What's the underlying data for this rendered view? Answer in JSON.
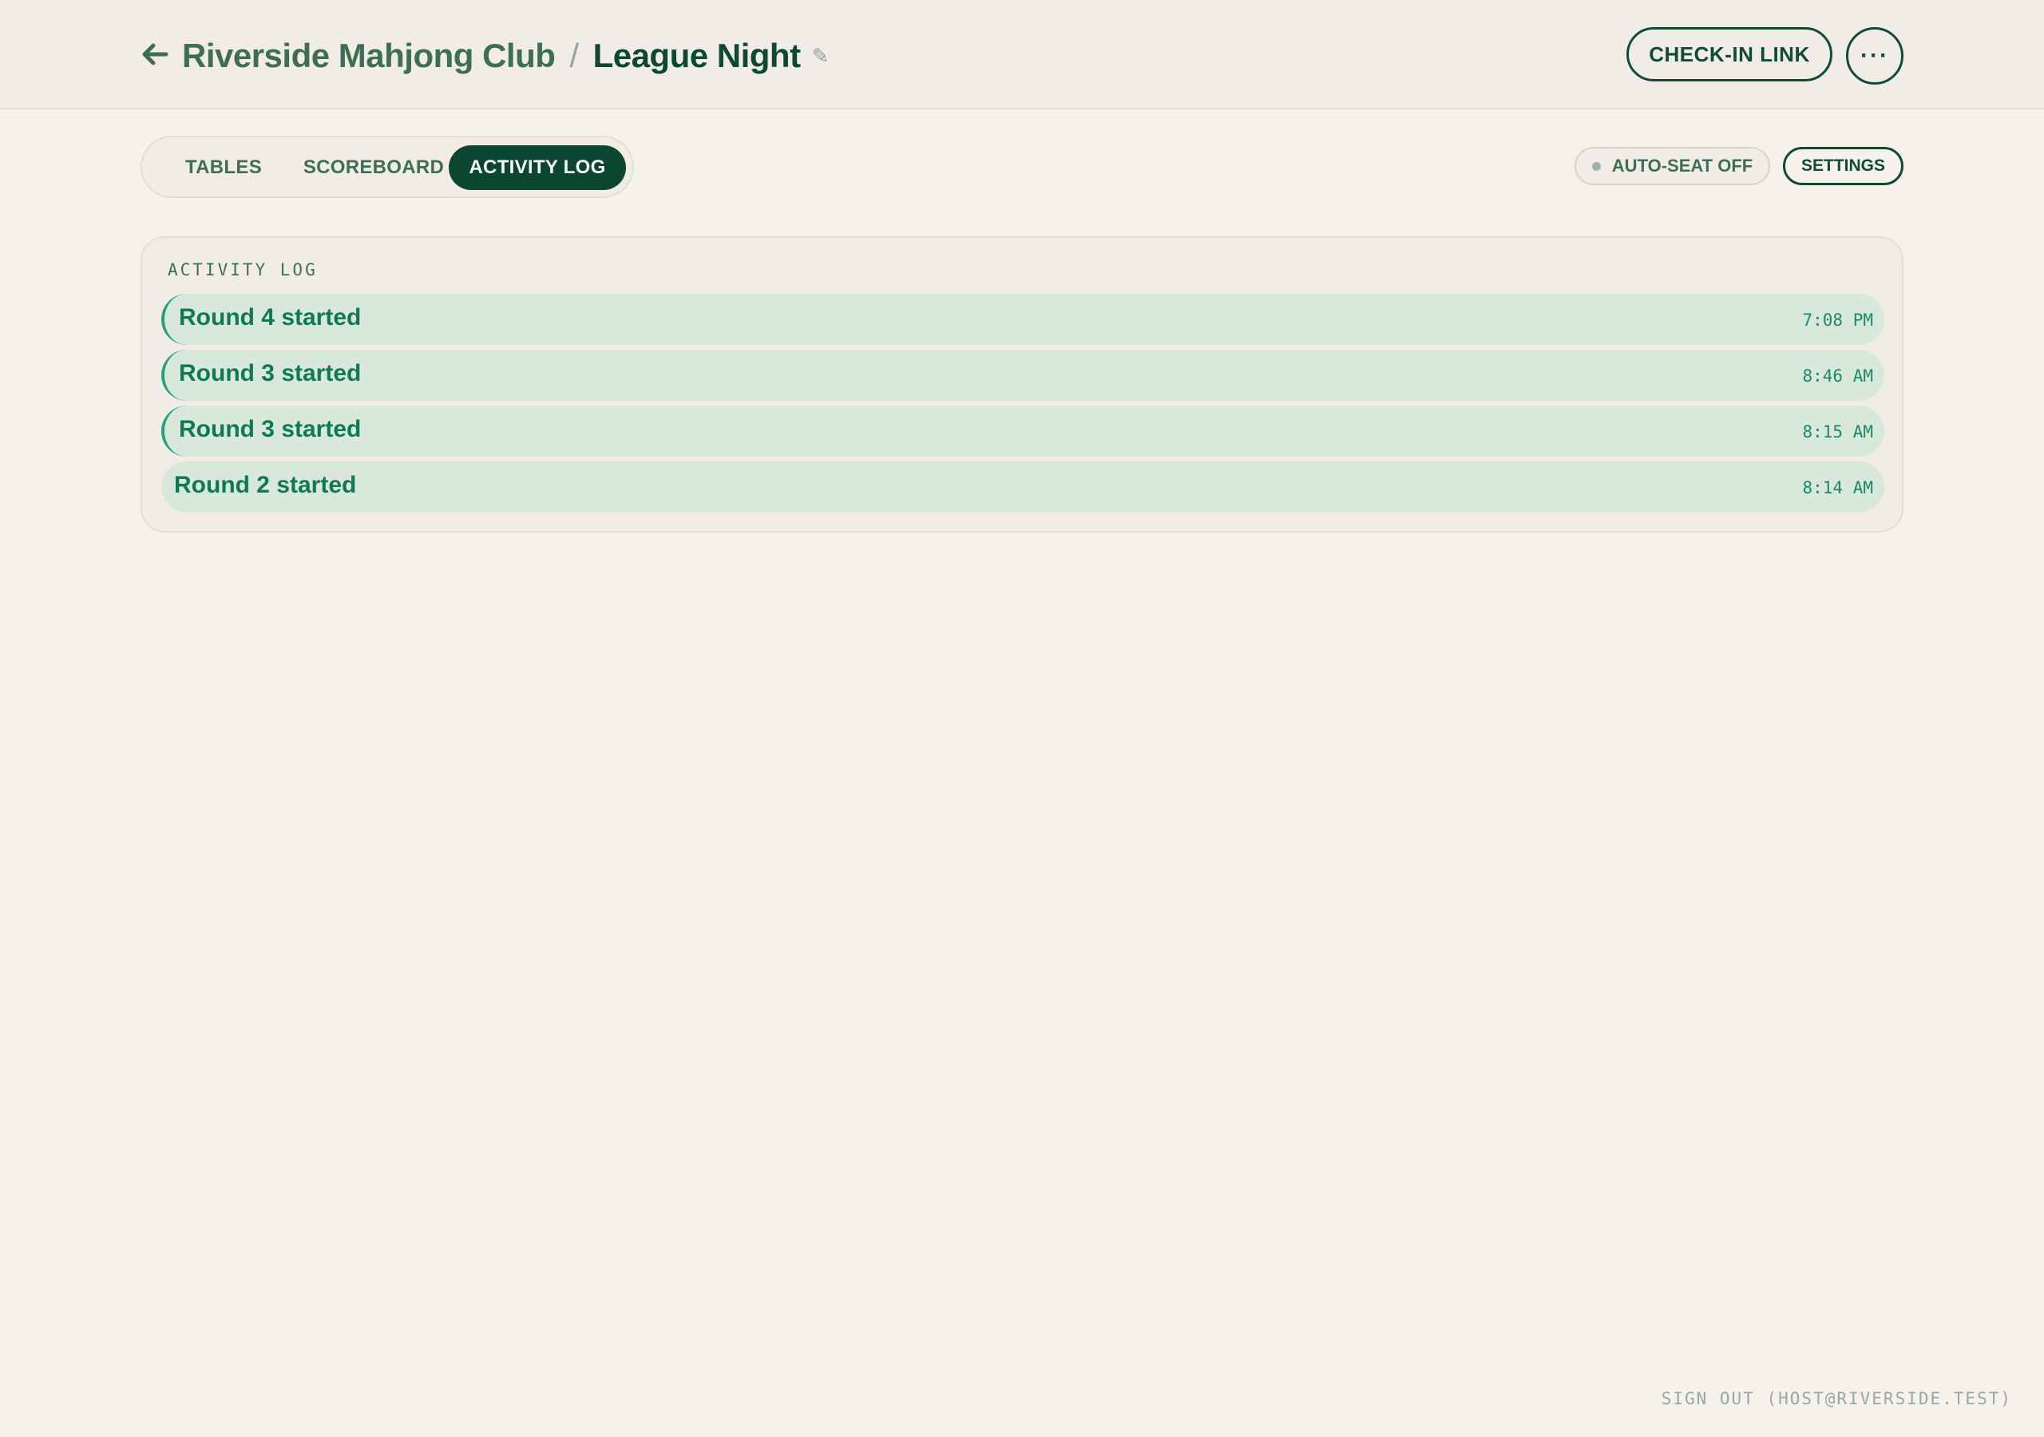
{
  "header": {
    "club_name": "Riverside Mahjong Club",
    "separator": "/",
    "event_name": "League Night",
    "edit_icon_glyph": "✎",
    "checkin_label": "CHECK-IN LINK",
    "more_label": "···"
  },
  "tabs": [
    {
      "label": "TABLES",
      "active": false
    },
    {
      "label": "SCOREBOARD",
      "active": false
    },
    {
      "label": "ACTIVITY LOG",
      "active": true
    }
  ],
  "toolbar": {
    "autoseat_label": "AUTO-SEAT OFF",
    "settings_label": "SETTINGS"
  },
  "activity_log": {
    "title": "ACTIVITY LOG",
    "entries": [
      {
        "message": "Round 4 started",
        "time": "7:08 PM"
      },
      {
        "message": "Round 3 started",
        "time": "8:46 AM"
      },
      {
        "message": "Round 3 started",
        "time": "8:15 AM"
      },
      {
        "message": "Round 2 started",
        "time": "8:14 AM"
      }
    ]
  },
  "footer": {
    "signout_label": "SIGN OUT (HOST@RIVERSIDE.TEST)"
  },
  "colors": {
    "background": "#f6f2eb",
    "primary": "#0a4630",
    "accent": "#1ea37a",
    "log_row": "#d8e9db"
  },
  "icons": {
    "back": "arrow-left-icon",
    "edit": "pencil-icon",
    "more": "more-horizontal-icon",
    "status": "dot-icon"
  }
}
